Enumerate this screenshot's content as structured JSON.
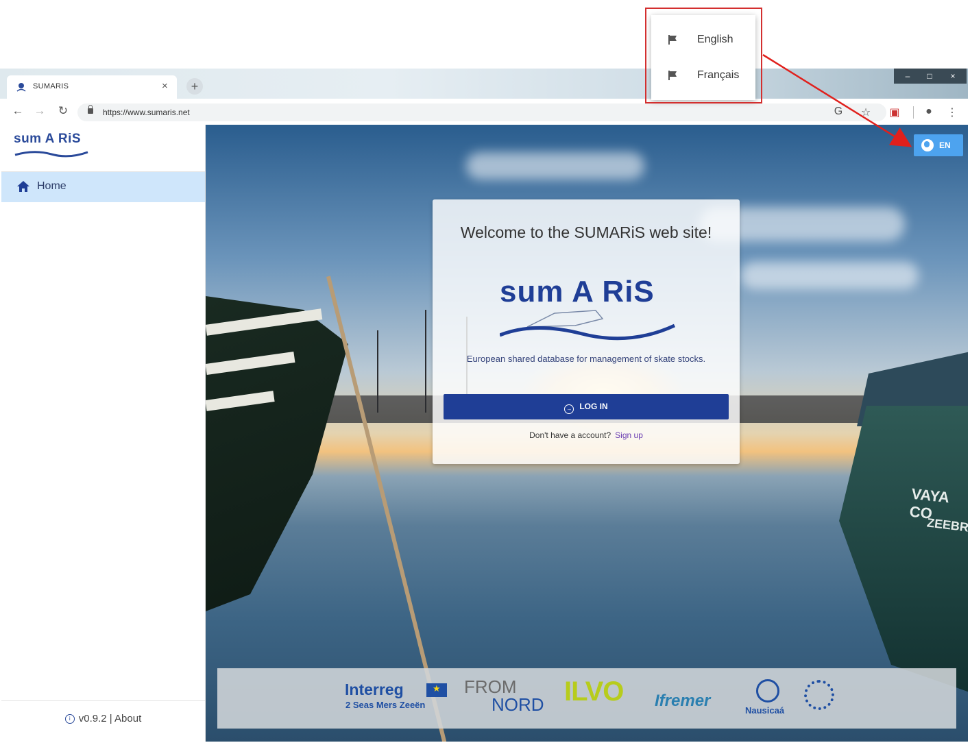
{
  "browser": {
    "tab_title": "SUMARIS",
    "tab_close": "×",
    "new_tab": "+",
    "url": "https://www.sumaris.net",
    "icons": [
      "back-arrow-icon",
      "forward-arrow-icon",
      "reload-icon",
      "lock-icon",
      "translate-icon",
      "star-icon",
      "extension-icon",
      "account-icon",
      "menu-dots-icon"
    ],
    "window_controls": [
      "–",
      "□",
      "×"
    ]
  },
  "sidebar": {
    "logo_text": "sum A RiS",
    "items": [
      {
        "label": "Home",
        "icon": "home-icon",
        "active": true
      }
    ],
    "footer": {
      "version": "v0.9.2",
      "separator": "|",
      "about": "About"
    }
  },
  "main": {
    "language_button": {
      "label": "EN",
      "icon": "globe-icon"
    },
    "card": {
      "title": "Welcome to the SUMARiS web site!",
      "logo_text": "sum A RiS",
      "subtitle": "European shared database for management of skate stocks.",
      "login_label": "LOG IN",
      "signup_prompt": "Don't have a account?",
      "signup_link": "Sign up"
    },
    "photo": {
      "boat_name": "VAYA CO",
      "boat_port": "ZEEBR"
    },
    "partners": {
      "interreg": "Interreg",
      "interreg_sub": "2 Seas Mers Zeeën",
      "fromnord_top": "FROM",
      "fromnord_bottom": "NORD",
      "ilvo": "ILVO",
      "ifremer": "Ifremer",
      "nausicaa": "Nausicaá"
    }
  },
  "language_menu": {
    "items": [
      {
        "label": "English",
        "icon": "flag-icon"
      },
      {
        "label": "Français",
        "icon": "flag-icon"
      }
    ]
  },
  "colors": {
    "brand": "#1f3e96",
    "active_menu": "#cfe6fb",
    "lang_button": "#4da3ef",
    "highlight_frame": "#d32f2f",
    "signup_link": "#6a3db2"
  }
}
